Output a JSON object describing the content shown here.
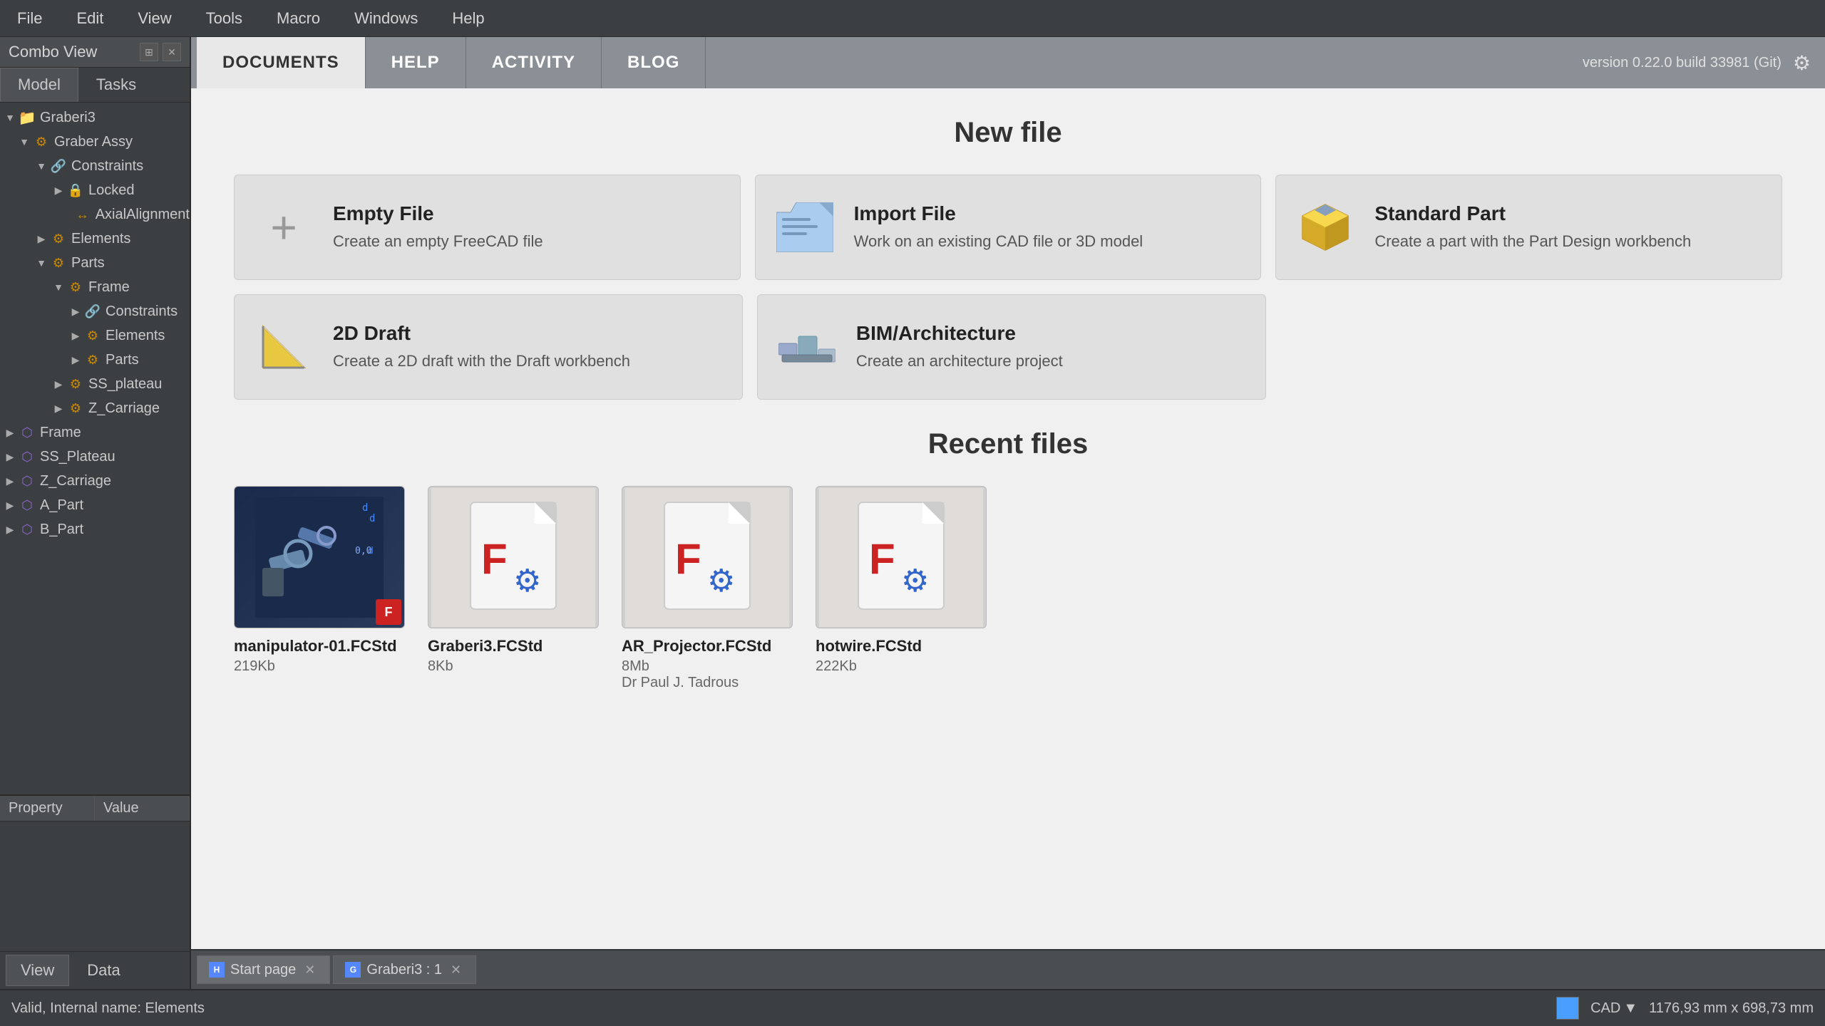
{
  "app": {
    "title": "Combo View",
    "version": "version 0.22.0 build 33981 (Git)"
  },
  "menubar": {
    "items": [
      "File",
      "Edit",
      "View",
      "Tools",
      "Macro",
      "Windows",
      "Help"
    ]
  },
  "sidebar": {
    "combo_view_title": "Combo View",
    "model_tab": "Model",
    "tasks_tab": "Tasks",
    "tree": [
      {
        "label": "Graberi3",
        "level": 0,
        "has_arrow": true,
        "expanded": true,
        "icon_type": "folder"
      },
      {
        "label": "Graber Assy",
        "level": 1,
        "has_arrow": true,
        "expanded": true,
        "icon_type": "assy"
      },
      {
        "label": "Constraints",
        "level": 2,
        "has_arrow": true,
        "expanded": true,
        "icon_type": "constraint"
      },
      {
        "label": "Locked",
        "level": 3,
        "has_arrow": true,
        "expanded": false,
        "icon_type": "lock"
      },
      {
        "label": "AxialAlignment",
        "level": 4,
        "has_arrow": false,
        "expanded": false,
        "icon_type": "align"
      },
      {
        "label": "Elements",
        "level": 2,
        "has_arrow": true,
        "expanded": false,
        "icon_type": "elements"
      },
      {
        "label": "Parts",
        "level": 2,
        "has_arrow": true,
        "expanded": true,
        "icon_type": "parts"
      },
      {
        "label": "Frame",
        "level": 3,
        "has_arrow": true,
        "expanded": true,
        "icon_type": "frame"
      },
      {
        "label": "Constraints",
        "level": 4,
        "has_arrow": true,
        "expanded": false,
        "icon_type": "constraint"
      },
      {
        "label": "Elements",
        "level": 4,
        "has_arrow": true,
        "expanded": false,
        "icon_type": "elements"
      },
      {
        "label": "Parts",
        "level": 4,
        "has_arrow": true,
        "expanded": false,
        "icon_type": "parts"
      },
      {
        "label": "SS_plateau",
        "level": 3,
        "has_arrow": true,
        "expanded": false,
        "icon_type": "part"
      },
      {
        "label": "Z_Carriage",
        "level": 3,
        "has_arrow": true,
        "expanded": false,
        "icon_type": "part"
      },
      {
        "label": "Frame",
        "level": 0,
        "has_arrow": true,
        "expanded": false,
        "icon_type": "frame2"
      },
      {
        "label": "SS_Plateau",
        "level": 0,
        "has_arrow": true,
        "expanded": false,
        "icon_type": "frame2"
      },
      {
        "label": "Z_Carriage",
        "level": 0,
        "has_arrow": true,
        "expanded": false,
        "icon_type": "frame2"
      },
      {
        "label": "A_Part",
        "level": 0,
        "has_arrow": true,
        "expanded": false,
        "icon_type": "frame2"
      },
      {
        "label": "B_Part",
        "level": 0,
        "has_arrow": true,
        "expanded": false,
        "icon_type": "frame2"
      }
    ],
    "property_header": [
      "Property",
      "Value"
    ],
    "view_tab": "View",
    "data_tab": "Data"
  },
  "nav": {
    "tabs": [
      "DOCUMENTS",
      "HELP",
      "ACTIVITY",
      "BLOG"
    ],
    "active_tab": "DOCUMENTS",
    "version": "version 0.22.0 build 33981 (Git)"
  },
  "new_file": {
    "title": "New file",
    "cards": [
      {
        "id": "empty-file",
        "title": "Empty File",
        "desc": "Create an empty FreeCAD file",
        "icon_type": "plus"
      },
      {
        "id": "import-file",
        "title": "Import File",
        "desc": "Work on an existing CAD file or 3D model",
        "icon_type": "import"
      },
      {
        "id": "standard-part",
        "title": "Standard Part",
        "desc": "Create a part with the Part Design workbench",
        "icon_type": "std-part"
      },
      {
        "id": "2d-draft",
        "title": "2D Draft",
        "desc": "Create a 2D draft with the Draft workbench",
        "icon_type": "draft"
      },
      {
        "id": "bim-architecture",
        "title": "BIM/Architecture",
        "desc": "Create an architecture project",
        "icon_type": "bim"
      }
    ]
  },
  "recent_files": {
    "title": "Recent files",
    "files": [
      {
        "name": "manipulator-01.FCStd",
        "size": "219Kb",
        "has_thumb": true
      },
      {
        "name": "Graberi3.FCStd",
        "size": "8Kb",
        "has_thumb": false
      },
      {
        "name": "AR_Projector.FCStd",
        "size": "8Mb",
        "author": "Dr Paul J. Tadrous",
        "has_thumb": false
      },
      {
        "name": "hotwire.FCStd",
        "size": "222Kb",
        "has_thumb": false
      }
    ]
  },
  "tab_bar": {
    "tabs": [
      {
        "label": "Start page",
        "id": "start-page",
        "closeable": true
      },
      {
        "label": "Graberi3 : 1",
        "id": "graberi3",
        "closeable": true
      }
    ]
  },
  "status_bar": {
    "text": "Valid, Internal name: Elements",
    "cad_label": "CAD",
    "coords": "1176,93 mm x 698,73 mm"
  }
}
